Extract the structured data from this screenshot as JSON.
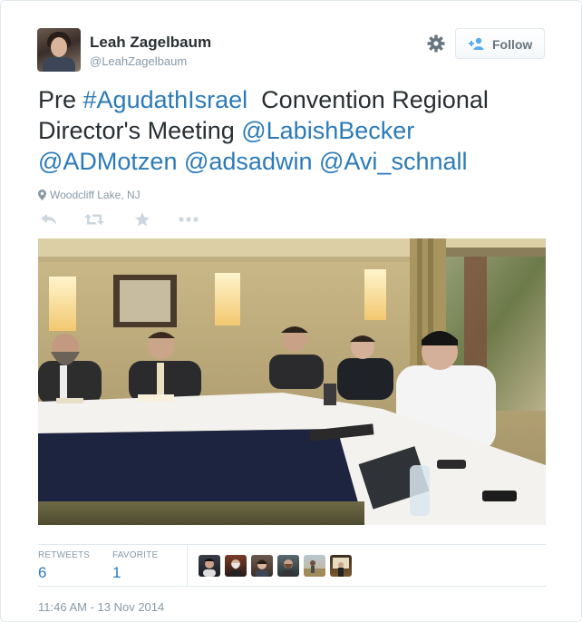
{
  "author": {
    "name": "Leah Zagelbaum",
    "handle": "@LeahZagelbaum"
  },
  "follow_button": {
    "label": "Follow"
  },
  "tweet": {
    "segments": [
      {
        "text": "Pre ",
        "type": "text"
      },
      {
        "text": "#AgudathIsrael",
        "type": "hashtag"
      },
      {
        "text": "  Convention Regional Director's Meeting ",
        "type": "text"
      },
      {
        "text": "@LabishBecker",
        "type": "mention"
      },
      {
        "text": " ",
        "type": "text"
      },
      {
        "text": "@ADMotzen",
        "type": "mention"
      },
      {
        "text": " ",
        "type": "text"
      },
      {
        "text": "@adsadwin",
        "type": "mention"
      },
      {
        "text": " ",
        "type": "text"
      },
      {
        "text": "@Avi_schnall",
        "type": "mention"
      }
    ]
  },
  "location": "Woodcliff Lake, NJ",
  "actions": [
    "reply-icon",
    "retweet-icon",
    "favorite-icon",
    "more-icon"
  ],
  "stats": {
    "retweets_label": "RETWEETS",
    "retweets_value": "6",
    "favorites_label": "FAVORITE",
    "favorites_value": "1"
  },
  "favoriters_count": 6,
  "timestamp": "11:46 AM - 13 Nov 2014",
  "colors": {
    "link": "#2b7bb9",
    "text": "#292f33",
    "muted": "#8899a6",
    "border": "#e1e8ed"
  }
}
